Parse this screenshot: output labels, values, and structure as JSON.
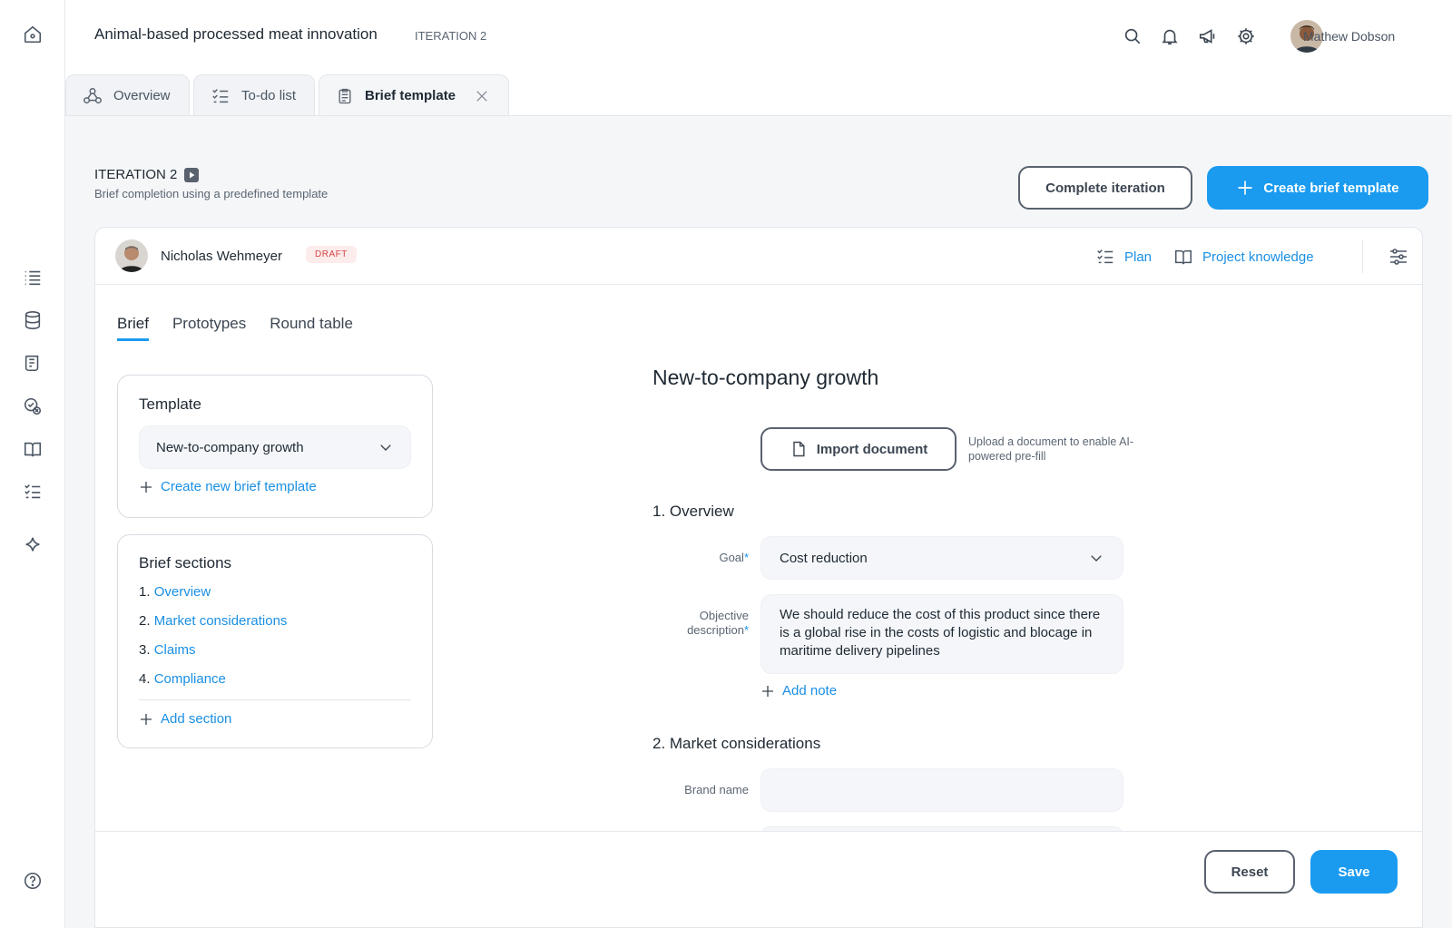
{
  "app": {
    "project_title": "Animal-based processed meat innovation",
    "iteration_tag": "ITERATION 2",
    "user_name": "Mathew Dobson",
    "accent_color": "#1a9bf0"
  },
  "rail": {
    "icons": [
      "home-icon",
      "list-icon",
      "database-icon",
      "document-icon",
      "badge-icon",
      "book-icon",
      "checklist-icon",
      "sparkle-icon",
      "help-icon"
    ]
  },
  "tabs": [
    {
      "label": "Overview",
      "icon": "network-icon"
    },
    {
      "label": "To-do list",
      "icon": "checklist-icon"
    },
    {
      "label": "Brief template",
      "icon": "clipboard-icon"
    }
  ],
  "iteration": {
    "title": "ITERATION 2",
    "subtitle": "Brief completion using a predefined template",
    "complete_label": "Complete iteration",
    "create_label": "Create brief template"
  },
  "card": {
    "author": "Nicholas Wehmeyer",
    "status": "DRAFT",
    "plan_label": "Plan",
    "knowledge_label": "Project knowledge"
  },
  "subtabs": [
    "Brief",
    "Prototypes",
    "Round table"
  ],
  "template_panel": {
    "title": "Template",
    "selected": "New-to-company growth",
    "create_link": "Create new brief template"
  },
  "sections_panel": {
    "title": "Brief sections",
    "items": [
      {
        "num": "1.",
        "label": "Overview"
      },
      {
        "num": "2.",
        "label": "Market considerations"
      },
      {
        "num": "3.",
        "label": "Claims"
      },
      {
        "num": "4.",
        "label": "Compliance"
      }
    ],
    "add_label": "Add section"
  },
  "form": {
    "title": "New-to-company growth",
    "import_label": "Import document",
    "import_hint": "Upload a document to enable AI-powered pre-fill",
    "section1": "1. Overview",
    "goal_label": "Goal",
    "goal_value": "Cost reduction",
    "objective_label_1": "Objective",
    "objective_label_2": "description",
    "objective_value": "We should reduce the cost of this product since there is a global rise in the costs of logistic and blocage in maritime delivery pipelines",
    "add_note": "Add note",
    "section2": "2. Market considerations",
    "brand_label": "Brand name",
    "brand_value": "",
    "required_mark": "*"
  },
  "footer": {
    "reset_label": "Reset",
    "save_label": "Save"
  }
}
